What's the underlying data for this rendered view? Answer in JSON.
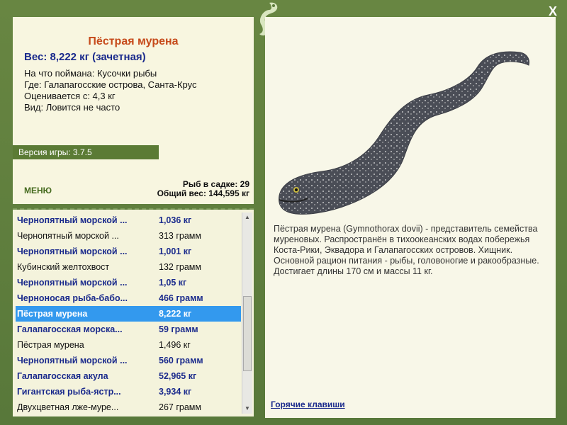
{
  "fish": {
    "title": "Пёстрая мурена",
    "weight": "Вес: 8,222 кг (зачетная)",
    "info": [
      "На что поймана: Кусочки рыбы",
      "Где: Галапагосские острова, Санта-Крус",
      "Оценивается с: 4,3 кг",
      "Вид: Ловится не часто"
    ],
    "description": "Пёстрая мурена (Gymnothorax dovii) - представитель семейства мурeновых. Распространён в тихоокеанских водах побережья Коста-Рики, Эквадора и Галапагосских островов. Хищник. Основной рацион питания - рыбы, головоногие и ракообразные. Достигает длины 170 см и массы 11 кг."
  },
  "version": "Версия игры: 3.7.5",
  "menu_label": "МЕНЮ",
  "stats": {
    "count": "Рыб в садке: 29",
    "total": "Общий вес: 144,595 кг"
  },
  "catch_list": [
    {
      "name": "Чернопятный морской ...",
      "weight": "1,036 кг",
      "style": "b"
    },
    {
      "name": "Чернопятный морской ...",
      "weight": "313 грамм",
      "style": "p"
    },
    {
      "name": "Чернопятный морской ...",
      "weight": "1,001 кг",
      "style": "b"
    },
    {
      "name": "Кубинский желтохвост",
      "weight": "132 грамм",
      "style": "p"
    },
    {
      "name": "Чернопятный морской ...",
      "weight": "1,05 кг",
      "style": "b"
    },
    {
      "name": "Черноносая рыба-бабо...",
      "weight": "466 грамм",
      "style": "b"
    },
    {
      "name": "Пёстрая мурена",
      "weight": "8,222 кг",
      "style": "sel"
    },
    {
      "name": "Галапагосская морска...",
      "weight": "59 грамм",
      "style": "b"
    },
    {
      "name": "Пёстрая мурена",
      "weight": "1,496 кг",
      "style": "p"
    },
    {
      "name": "Чернопятный морской ...",
      "weight": "560 грамм",
      "style": "b"
    },
    {
      "name": "Галапагосская акула",
      "weight": "52,965 кг",
      "style": "b"
    },
    {
      "name": "Гигантская рыба-ястр...",
      "weight": "3,934 кг",
      "style": "b"
    },
    {
      "name": "Двухцветная лже-муре...",
      "weight": "267 грамм",
      "style": "p"
    }
  ],
  "hotkeys_label": "Горячие клавиши",
  "close_label": "X",
  "colors": {
    "accent": "#3399ee",
    "frame": "#5c7a3c",
    "title": "#c64a1a",
    "weight": "#1a2a8c"
  }
}
